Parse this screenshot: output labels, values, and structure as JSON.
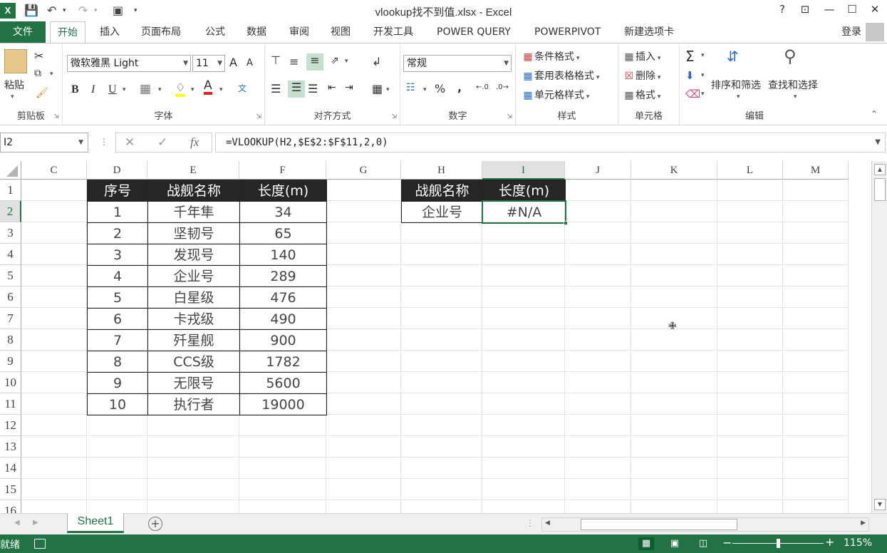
{
  "window": {
    "title": "vlookup找不到值.xlsx - Excel",
    "app_logo": "X",
    "help": "?",
    "minimize": "—",
    "maximize": "☐",
    "close": "✕",
    "restore_ribbon": "⊡"
  },
  "quick_access": {
    "save_icon": "save-icon",
    "undo_icon": "undo-icon",
    "redo_icon": "redo-icon",
    "camera_icon": "camera-icon"
  },
  "tabs": {
    "file": "文件",
    "items": [
      "开始",
      "插入",
      "页面布局",
      "公式",
      "数据",
      "审阅",
      "视图",
      "开发工具",
      "POWER QUERY",
      "POWERPIVOT",
      "新建选项卡"
    ],
    "active": "开始",
    "login": "登录"
  },
  "ribbon": {
    "clipboard": {
      "label": "剪贴板",
      "paste": "粘贴"
    },
    "font": {
      "label": "字体",
      "font_name": "微软雅黑 Light",
      "font_size": "11",
      "bold": "B",
      "italic": "I",
      "underline": "U",
      "grow": "A",
      "shrink": "A",
      "phonetic": "文"
    },
    "alignment": {
      "label": "对齐方式"
    },
    "number": {
      "label": "数字",
      "format": "常规",
      "percent": "%",
      "comma": ","
    },
    "styles": {
      "label": "样式",
      "conditional": "条件格式",
      "table": "套用表格格式",
      "cell_styles": "单元格样式"
    },
    "cells": {
      "label": "单元格",
      "insert": "插入",
      "delete": "删除",
      "format": "格式"
    },
    "editing": {
      "label": "编辑",
      "sort_filter": "排序和筛选",
      "find_select": "查找和选择"
    }
  },
  "formula_bar": {
    "name_box": "I2",
    "formula": "=VLOOKUP(H2,$E$2:$F$11,2,0)"
  },
  "columns": [
    "C",
    "D",
    "E",
    "F",
    "G",
    "H",
    "I",
    "J",
    "K",
    "L",
    "M"
  ],
  "selected_column": "I",
  "rows": [
    "1",
    "2",
    "3",
    "4",
    "5",
    "6",
    "7",
    "8",
    "9",
    "10",
    "11",
    "12",
    "13",
    "14",
    "15",
    "16"
  ],
  "selected_row": "2",
  "source_table": {
    "headers": [
      "序号",
      "战舰名称",
      "长度(m)"
    ],
    "rows": [
      [
        "1",
        "千年隼",
        "34"
      ],
      [
        "2",
        "坚韧号",
        "65"
      ],
      [
        "3",
        "发现号",
        "140"
      ],
      [
        "4",
        "企业号",
        "289"
      ],
      [
        "5",
        "白星级",
        "476"
      ],
      [
        "6",
        "卡戎级",
        "490"
      ],
      [
        "7",
        "歼星舰",
        "900"
      ],
      [
        "8",
        "CCS级",
        "1782"
      ],
      [
        "9",
        "无限号",
        "5600"
      ],
      [
        "10",
        "执行者",
        "19000"
      ]
    ]
  },
  "lookup_table": {
    "headers": [
      "战舰名称",
      "长度(m)"
    ],
    "row": [
      "企业号",
      "#N/A"
    ]
  },
  "sheets": [
    "Sheet1"
  ],
  "status": {
    "ready": "就绪",
    "zoom": "115%"
  },
  "colors": {
    "accent": "#217346",
    "header_fill": "#262626"
  }
}
